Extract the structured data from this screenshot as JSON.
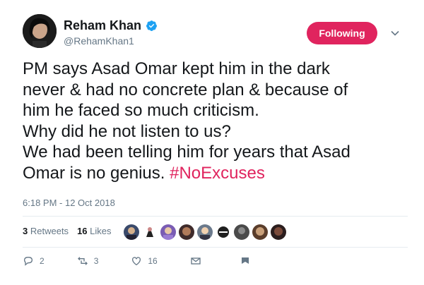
{
  "user": {
    "display_name": "Reham Khan",
    "handle": "@RehamKhan1",
    "verified_icon": "verified-badge-icon"
  },
  "follow_button": {
    "label": "Following",
    "color": "#e0245e"
  },
  "tweet": {
    "text_lines": [
      "PM says Asad Omar kept him in the dark",
      "never & had no concrete plan & because of",
      "him he faced so much criticism.",
      "Why did he not listen to us?",
      "We had been telling him for years that Asad",
      "Omar is no genius. "
    ],
    "hashtag": "#NoExcuses",
    "timestamp": "6:18 PM - 12 Oct 2018"
  },
  "stats": {
    "retweets_count": "3",
    "retweets_label": "Retweets",
    "likes_count": "16",
    "likes_label": "Likes"
  },
  "likers": [
    {
      "color": "#3a4a6b"
    },
    {
      "color": "#2b2b2b"
    },
    {
      "color": "#7a5cb3"
    },
    {
      "color": "#3f2b2b"
    },
    {
      "color": "#6b7a8c"
    },
    {
      "color": "#1f1f1f"
    },
    {
      "color": "#4a4a4a"
    },
    {
      "color": "#5a3d2b"
    },
    {
      "color": "#2b1e1e"
    }
  ],
  "actions": {
    "reply_count": "2",
    "retweet_count": "3",
    "like_count": "16"
  },
  "colors": {
    "accent": "#e0245e",
    "text_primary": "#14171a",
    "text_secondary": "#657786",
    "verified": "#1da1f2"
  }
}
